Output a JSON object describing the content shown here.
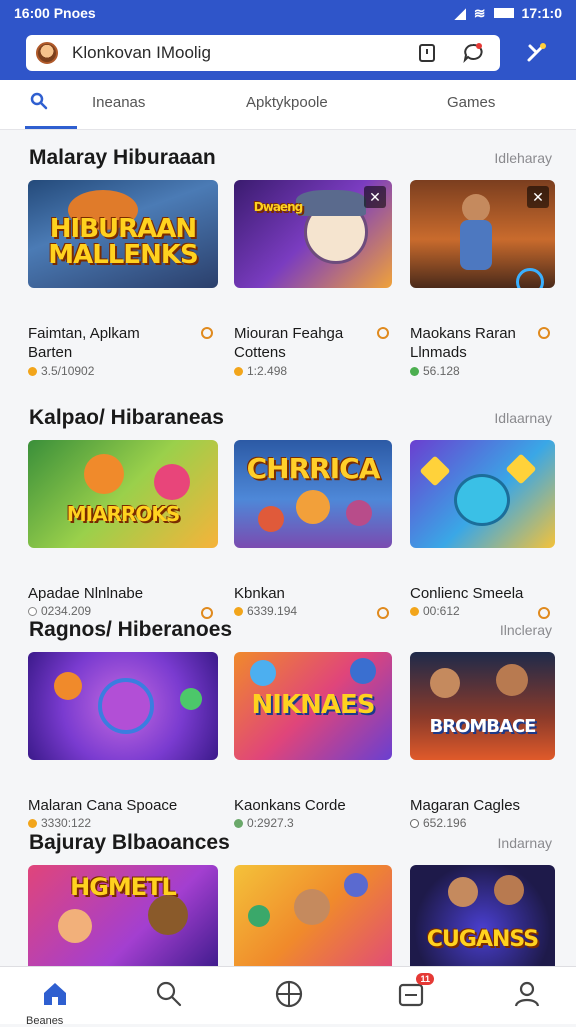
{
  "status": {
    "time": "16:00 Pnoes",
    "right_text": "17:1:0"
  },
  "search": {
    "text": "Klonkovan IMoolig"
  },
  "tabs": [
    {
      "label": "Ineanas"
    },
    {
      "label": "Apktykpoole"
    },
    {
      "label": "Games"
    }
  ],
  "sections": [
    {
      "title": "Malaray Hiburaaan",
      "more": "Idleharay",
      "cards": [
        {
          "name": "Faimtan, Aplkam\nBarten",
          "rating": "3.5/10902",
          "art": "HIBURAAN\nMALLENKS"
        },
        {
          "name": "Miouran Feahga\nCottens",
          "rating": "1:2.498",
          "art": "Dwaeng"
        },
        {
          "name": "Maokans Raran\nLlnmads",
          "rating": "56.128",
          "art": ""
        }
      ]
    },
    {
      "title": "Kalpao/ Hibaraneas",
      "more": "Idlaarnay",
      "cards": [
        {
          "name": "Apadae Nlnlnabe",
          "rating": "0234.209",
          "art": "MIARROKS"
        },
        {
          "name": "Kbnkan",
          "rating": "6339.194",
          "art": "CHRRICA"
        },
        {
          "name": "Conlienc Smeela",
          "rating": "00:612",
          "art": ""
        }
      ]
    },
    {
      "title": "Ragnos/ Hiberanoes",
      "more": "Ilncleray",
      "cards": [
        {
          "name": "Malaran Cana Spoace",
          "rating": "3330:122",
          "art": ""
        },
        {
          "name": "Kaonkans Corde",
          "rating": "0:2927.3",
          "art": "NIKNAES"
        },
        {
          "name": "Magaran Cagles",
          "rating": "652.196",
          "art": "BROMBACE"
        }
      ]
    },
    {
      "title": "Bajuray Blbaoances",
      "more": "Indarnay",
      "cards": [
        {
          "name": "",
          "rating": "",
          "art": "HGMETL"
        },
        {
          "name": "",
          "rating": "",
          "art": ""
        },
        {
          "name": "",
          "rating": "",
          "art": "CUGANSS"
        }
      ]
    }
  ],
  "nav": {
    "home_label": "Beanes",
    "notification_count": "11"
  },
  "colors": {
    "brand": "#2f55c9",
    "accent": "#2f5fd0",
    "star": "#f2a51b"
  }
}
